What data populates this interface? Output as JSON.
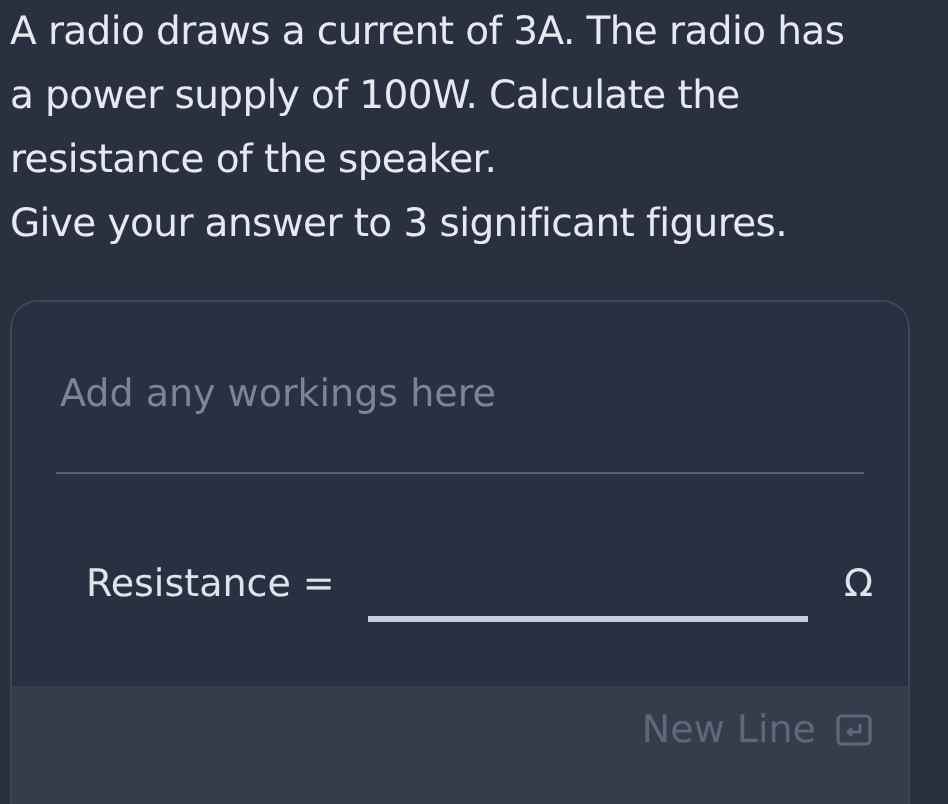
{
  "question": {
    "lines": [
      "A radio draws a current of 3A. The radio has",
      "a power supply of 100W. Calculate the",
      "resistance of the speaker.",
      "Give your answer to 3 significant figures."
    ]
  },
  "workings": {
    "placeholder": "Add any workings here"
  },
  "answer": {
    "label": "Resistance =",
    "unit": "Ω"
  },
  "footer": {
    "button": "New Line"
  }
}
